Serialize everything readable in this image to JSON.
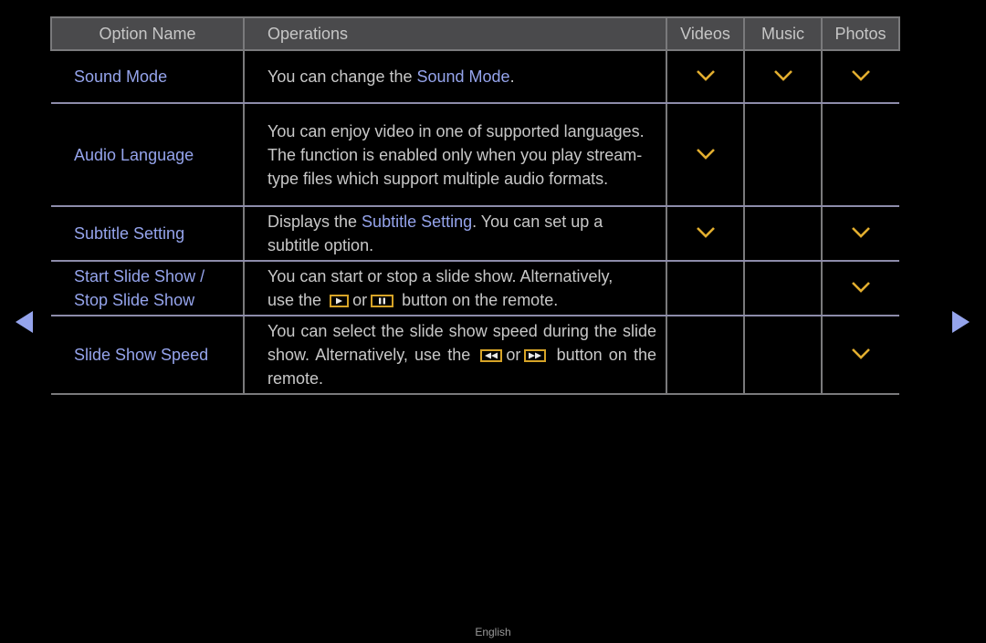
{
  "header": {
    "option_name": "Option Name",
    "operations": "Operations",
    "videos": "Videos",
    "music": "Music",
    "photos": "Photos"
  },
  "rows": [
    {
      "name": "Sound Mode",
      "ops_pre": "You can change the ",
      "ops_hl": "Sound Mode",
      "ops_post": ".",
      "videos": true,
      "music": true,
      "photos": true
    },
    {
      "name": "Audio Language",
      "ops_text": "You can enjoy video in one of supported languages. The function is enabled only when you play stream-type files which support multiple audio formats.",
      "videos": true,
      "music": false,
      "photos": false
    },
    {
      "name": "Subtitle Setting",
      "ops_pre": "Displays the ",
      "ops_hl": "Subtitle Setting",
      "ops_post": ". You can set up a subtitle option.",
      "videos": true,
      "music": false,
      "photos": true
    },
    {
      "name_line1": "Start Slide Show /",
      "name_line2": "Stop Slide Show",
      "ops_line1": "You can start or stop a slide show. Alternatively,",
      "ops_pre": "use the",
      "ops_or": "or",
      "ops_post": "button on the remote.",
      "icon1": "play-button-icon",
      "icon2": "pause-button-icon",
      "videos": false,
      "music": false,
      "photos": true
    },
    {
      "name": "Slide Show Speed",
      "ops_pre": "You can select the slide show speed during the slide show. Alternatively, use the",
      "ops_or": "or",
      "ops_post": "button on the remote.",
      "icon1": "rewind-button-icon",
      "icon2": "fast-forward-button-icon",
      "videos": false,
      "music": false,
      "photos": true
    }
  ],
  "colors": {
    "accent": "#95a4ec",
    "check": "#e2ae2f",
    "header_bg": "#4a4a4c"
  },
  "nav": {
    "prev": "previous-page",
    "next": "next-page"
  },
  "footer": {
    "language": "English"
  }
}
